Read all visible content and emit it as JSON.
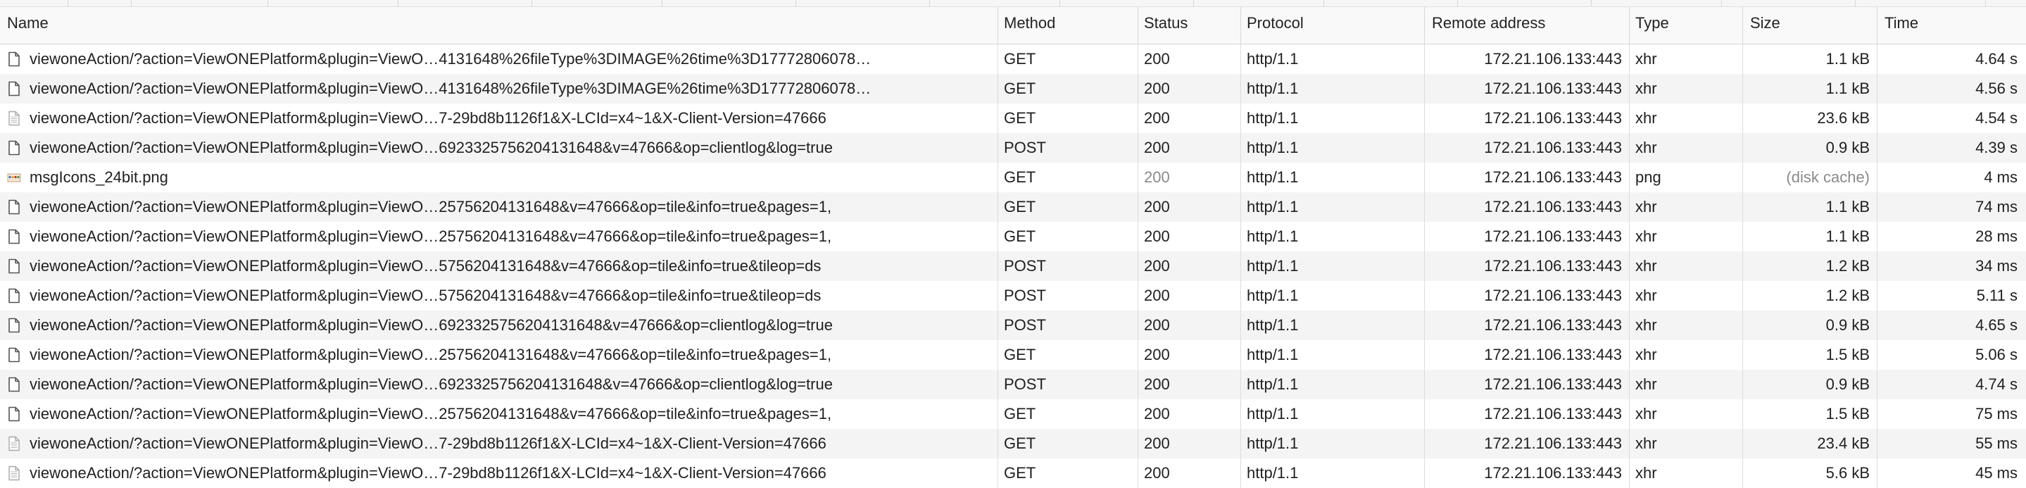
{
  "columns": {
    "name": "Name",
    "method": "Method",
    "status": "Status",
    "protocol": "Protocol",
    "remote_address": "Remote address",
    "type": "Type",
    "size": "Size",
    "time": "Time"
  },
  "rows": [
    {
      "icon": "document-icon",
      "name": "viewoneAction/?action=ViewONEPlatform&plugin=ViewO…4131648%26fileType%3DIMAGE%26time%3D17772806078…",
      "method": "GET",
      "status": "200",
      "protocol": "http/1.1",
      "remote": "172.21.106.133:443",
      "type": "xhr",
      "size": "1.1 kB",
      "time": "4.64 s"
    },
    {
      "icon": "document-icon",
      "name": "viewoneAction/?action=ViewONEPlatform&plugin=ViewO…4131648%26fileType%3DIMAGE%26time%3D17772806078…",
      "method": "GET",
      "status": "200",
      "protocol": "http/1.1",
      "remote": "172.21.106.133:443",
      "type": "xhr",
      "size": "1.1 kB",
      "time": "4.56 s"
    },
    {
      "icon": "text-document-icon",
      "name": "viewoneAction/?action=ViewONEPlatform&plugin=ViewO…7-29bd8b1126f1&X-LCId=x4~1&X-Client-Version=47666",
      "method": "GET",
      "status": "200",
      "protocol": "http/1.1",
      "remote": "172.21.106.133:443",
      "type": "xhr",
      "size": "23.6 kB",
      "time": "4.54 s"
    },
    {
      "icon": "document-icon",
      "name": "viewoneAction/?action=ViewONEPlatform&plugin=ViewO…6923325756204131648&v=47666&op=clientlog&log=true",
      "method": "POST",
      "status": "200",
      "protocol": "http/1.1",
      "remote": "172.21.106.133:443",
      "type": "xhr",
      "size": "0.9 kB",
      "time": "4.39 s"
    },
    {
      "icon": "image-icon",
      "name": "msgIcons_24bit.png",
      "method": "GET",
      "status": "200",
      "status_muted": true,
      "protocol": "http/1.1",
      "remote": "172.21.106.133:443",
      "type": "png",
      "size": "(disk cache)",
      "size_muted": true,
      "time": "4 ms"
    },
    {
      "icon": "document-icon",
      "name": "viewoneAction/?action=ViewONEPlatform&plugin=ViewO…25756204131648&v=47666&op=tile&info=true&pages=1,",
      "method": "GET",
      "status": "200",
      "protocol": "http/1.1",
      "remote": "172.21.106.133:443",
      "type": "xhr",
      "size": "1.1 kB",
      "time": "74 ms"
    },
    {
      "icon": "document-icon",
      "name": "viewoneAction/?action=ViewONEPlatform&plugin=ViewO…25756204131648&v=47666&op=tile&info=true&pages=1,",
      "method": "GET",
      "status": "200",
      "protocol": "http/1.1",
      "remote": "172.21.106.133:443",
      "type": "xhr",
      "size": "1.1 kB",
      "time": "28 ms"
    },
    {
      "icon": "document-icon",
      "name": "viewoneAction/?action=ViewONEPlatform&plugin=ViewO…5756204131648&v=47666&op=tile&info=true&tileop=ds",
      "method": "POST",
      "status": "200",
      "protocol": "http/1.1",
      "remote": "172.21.106.133:443",
      "type": "xhr",
      "size": "1.2 kB",
      "time": "34 ms"
    },
    {
      "icon": "document-icon",
      "name": "viewoneAction/?action=ViewONEPlatform&plugin=ViewO…5756204131648&v=47666&op=tile&info=true&tileop=ds",
      "method": "POST",
      "status": "200",
      "protocol": "http/1.1",
      "remote": "172.21.106.133:443",
      "type": "xhr",
      "size": "1.2 kB",
      "time": "5.11 s"
    },
    {
      "icon": "document-icon",
      "name": "viewoneAction/?action=ViewONEPlatform&plugin=ViewO…6923325756204131648&v=47666&op=clientlog&log=true",
      "method": "POST",
      "status": "200",
      "protocol": "http/1.1",
      "remote": "172.21.106.133:443",
      "type": "xhr",
      "size": "0.9 kB",
      "time": "4.65 s"
    },
    {
      "icon": "document-icon",
      "name": "viewoneAction/?action=ViewONEPlatform&plugin=ViewO…25756204131648&v=47666&op=tile&info=true&pages=1,",
      "method": "GET",
      "status": "200",
      "protocol": "http/1.1",
      "remote": "172.21.106.133:443",
      "type": "xhr",
      "size": "1.5 kB",
      "time": "5.06 s"
    },
    {
      "icon": "document-icon",
      "name": "viewoneAction/?action=ViewONEPlatform&plugin=ViewO…6923325756204131648&v=47666&op=clientlog&log=true",
      "method": "POST",
      "status": "200",
      "protocol": "http/1.1",
      "remote": "172.21.106.133:443",
      "type": "xhr",
      "size": "0.9 kB",
      "time": "4.74 s"
    },
    {
      "icon": "document-icon",
      "name": "viewoneAction/?action=ViewONEPlatform&plugin=ViewO…25756204131648&v=47666&op=tile&info=true&pages=1,",
      "method": "GET",
      "status": "200",
      "protocol": "http/1.1",
      "remote": "172.21.106.133:443",
      "type": "xhr",
      "size": "1.5 kB",
      "time": "75 ms"
    },
    {
      "icon": "text-document-icon",
      "name": "viewoneAction/?action=ViewONEPlatform&plugin=ViewO…7-29bd8b1126f1&X-LCId=x4~1&X-Client-Version=47666",
      "method": "GET",
      "status": "200",
      "protocol": "http/1.1",
      "remote": "172.21.106.133:443",
      "type": "xhr",
      "size": "23.4 kB",
      "time": "55 ms"
    },
    {
      "icon": "text-document-icon",
      "name": "viewoneAction/?action=ViewONEPlatform&plugin=ViewO…7-29bd8b1126f1&X-LCId=x4~1&X-Client-Version=47666",
      "method": "GET",
      "status": "200",
      "protocol": "http/1.1",
      "remote": "172.21.106.133:443",
      "type": "xhr",
      "size": "5.6 kB",
      "time": "45 ms"
    }
  ]
}
